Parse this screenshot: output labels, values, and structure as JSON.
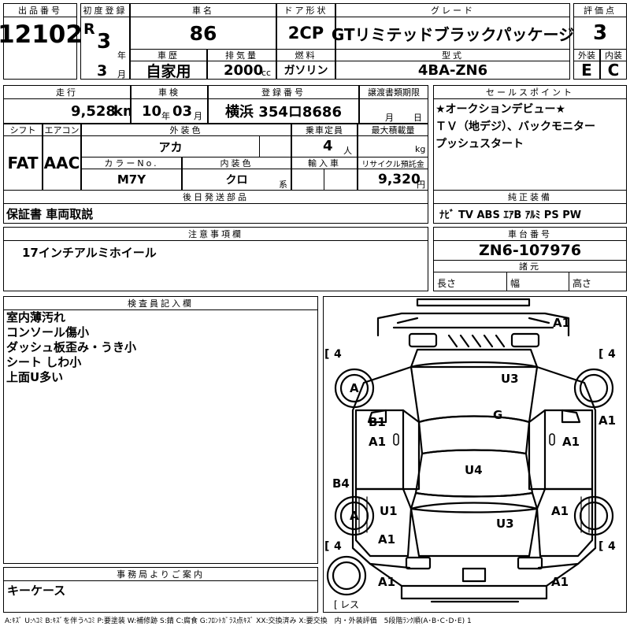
{
  "header": {
    "lot_label": "出品番号",
    "lot_no": "12102",
    "first_reg_label": "初度登録",
    "era": "R",
    "year": "3",
    "year_unit": "年",
    "month": "3",
    "month_unit": "月",
    "car_name_label": "車名",
    "car_name": "86",
    "door_label": "ドア形状",
    "door": "2CP",
    "grade_label": "グレード",
    "grade": "GTリミテッドブラックパッケージ",
    "score_label": "評価点",
    "score": "3",
    "history_label": "車歴",
    "history": "自家用",
    "displacement_label": "排気量",
    "displacement": "2000",
    "cc_unit": "cc",
    "fuel_label": "燃料",
    "fuel": "ガソリン",
    "model_label": "型式",
    "model": "4BA-ZN6",
    "exterior_label": "外装",
    "exterior": "E",
    "interior_label": "内装",
    "interior": "C"
  },
  "row2": {
    "mileage_label": "走行",
    "mileage": "9,528",
    "mileage_unit": "km",
    "inspection_label": "車検",
    "inspection_year": "10",
    "inspection_year_unit": "年",
    "inspection_month": "03",
    "inspection_month_unit": "月",
    "plate_label": "登録番号",
    "plate": "横浜 354ロ8686",
    "transfer_label": "譲渡書類期限",
    "transfer_month_unit": "月",
    "transfer_day_unit": "日",
    "sales_label": "セールスポイント",
    "sales_points": [
      "★オークションデビュー★",
      "ＴＶ（地デジ）、バックモニター",
      "プッシュスタート"
    ]
  },
  "row3": {
    "shift_label": "シフト",
    "shift": "FAT",
    "ac_label": "エアコン",
    "ac": "AAC",
    "ext_color_label": "外装色",
    "ext_color": "アカ",
    "capacity_label": "乗車定員",
    "capacity": "4",
    "capacity_unit": "人",
    "payload_label": "最大積載量",
    "payload_unit": "kg",
    "color_no_label": "カラーNo.",
    "color_no": "M7Y",
    "int_color_label": "内装色",
    "int_color": "クロ",
    "int_color_suffix": "系",
    "import_label": "輸入車",
    "recycle_label": "リサイクル預託金",
    "recycle": "9,320",
    "recycle_unit": "円"
  },
  "parts": {
    "label": "後日発送部品",
    "value": "保証書 車両取説"
  },
  "equipment": {
    "label": "純正装備",
    "value": "ﾅﾋﾞ TV ABS ｴｱB ｱﾙﾐ PS PW"
  },
  "notes": {
    "label": "注意事項欄",
    "value": "17インチアルミホイール"
  },
  "chassis": {
    "label": "車台番号",
    "value": "ZN6-107976",
    "spec_label": "諸元",
    "length_label": "長さ",
    "width_label": "幅",
    "height_label": "高さ"
  },
  "inspector": {
    "label": "検査員記入欄",
    "lines": [
      "室内薄汚れ",
      "コンソール傷小",
      "ダッシュ板歪み・うき小",
      "シート しわ小",
      "上面U多い"
    ]
  },
  "office": {
    "label": "事務局よりご案内",
    "value": "キーケース"
  },
  "diagram": {
    "tyre_fl": "4",
    "tyre_fr": "4",
    "tyre_rl": "4",
    "tyre_rr": "4",
    "spare": "レス",
    "marks": {
      "front_bumper": "A1",
      "hood": "U3",
      "roof": "G",
      "front_right_fender": "A1",
      "left_front_door_top": "B1",
      "left_front_door": "A1",
      "right_front_door": "A1",
      "trunk": "U4",
      "left_rocker": "B4",
      "left_rear_quarter": "U1",
      "right_rear_quarter": "A1",
      "rear_glass": "U3",
      "left_rear_lower": "A1",
      "rear_bumper_left": "A1",
      "rear_bumper_right": "A1",
      "front_left_wheel": "A",
      "rear_left_wheel": "A"
    }
  },
  "legend": "A:ｷｽﾞ U:ﾍｺﾐ B:ｷｽﾞを伴うﾍｺﾐ P:要塗装 W:補修跡 S:錆 C:腐食 G:ﾌﾛﾝﾄｶﾞﾗｽ点ｷｽﾞ XX:交換済み X:要交換　内・外装評価　5段階ﾗﾝｸ順(A･B･C･D･E) 1"
}
